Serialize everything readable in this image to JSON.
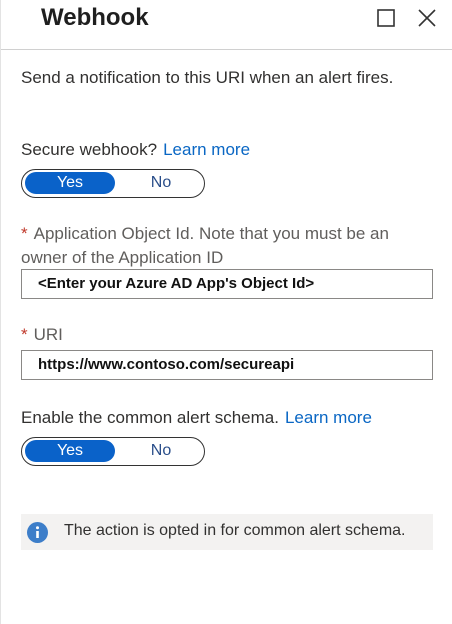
{
  "header": {
    "title": "Webhook",
    "maximize_icon": "maximize-icon",
    "close_icon": "close-icon"
  },
  "description": "Send a notification to this URI when an alert fires.",
  "secure_webhook": {
    "label": "Secure webhook?",
    "link": "Learn more",
    "toggle": {
      "yes": "Yes",
      "no": "No",
      "selected": "Yes"
    }
  },
  "application_object_id": {
    "required_marker": "*",
    "label": "Application Object Id. Note that you must be an owner of the Application ID",
    "value": "<Enter your Azure AD App's Object Id>"
  },
  "uri": {
    "required_marker": "*",
    "label": "URI",
    "value": "https://www.contoso.com/secureapi"
  },
  "common_alert_schema": {
    "label": "Enable the common alert schema.",
    "link": "Learn more",
    "toggle": {
      "yes": "Yes",
      "no": "No",
      "selected": "Yes"
    }
  },
  "info": {
    "icon": "info-icon",
    "text": "The action is opted in for common alert schema."
  },
  "colors": {
    "accent": "#0a62c9",
    "link": "#0a67c4",
    "required": "#c0392b",
    "info_background": "#f3f2f1",
    "info_icon": "#3d7ec9"
  }
}
